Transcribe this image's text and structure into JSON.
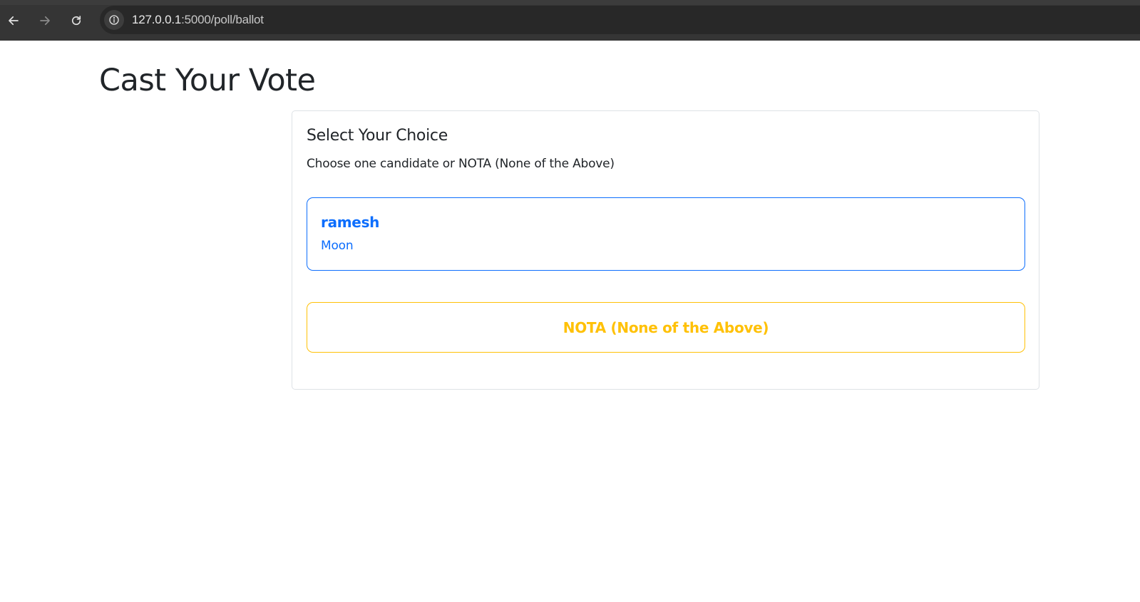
{
  "browser": {
    "url_host": "127.0.0.1",
    "url_rest": ":5000/poll/ballot"
  },
  "page": {
    "title": "Cast Your Vote"
  },
  "ballot": {
    "heading": "Select Your Choice",
    "instructions": "Choose one candidate or NOTA (None of the Above)",
    "candidates": [
      {
        "name": "ramesh",
        "symbol": "Moon"
      }
    ],
    "nota_label": "NOTA (None of the Above)"
  },
  "colors": {
    "primary": "#0d6efd",
    "warning": "#ffc107",
    "text": "#212529",
    "border": "#dee2e6"
  },
  "icons": {
    "back": "arrow-left-icon",
    "forward": "arrow-right-icon",
    "reload": "reload-icon",
    "site_info": "info-icon"
  }
}
